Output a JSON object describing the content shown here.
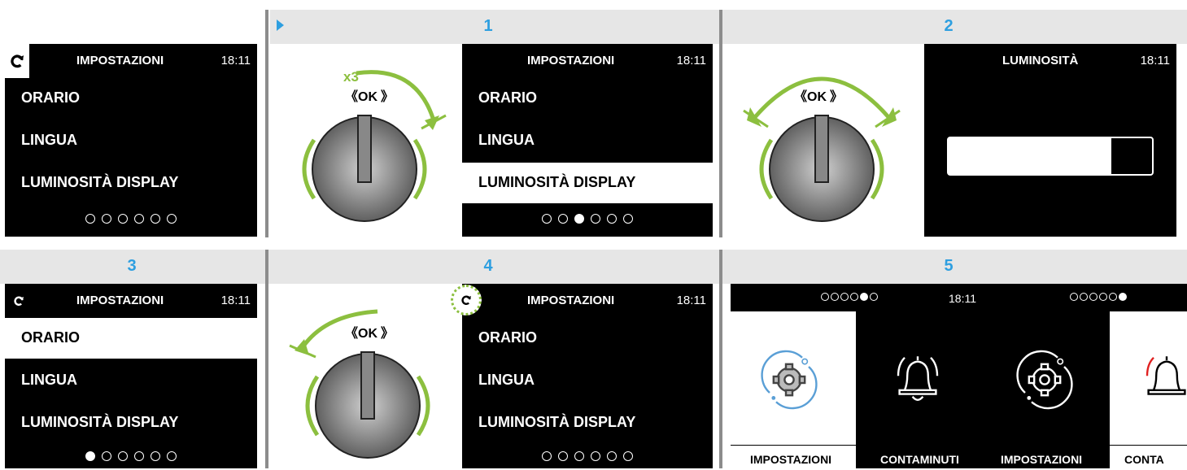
{
  "steps": {
    "s1": "1",
    "s2": "2",
    "s3": "3",
    "s4": "4",
    "s5": "5"
  },
  "time": "18:11",
  "settings": {
    "title": "IMPOSTAZIONI",
    "items": [
      "ORARIO",
      "LINGUA",
      "LUMINOSITÀ DISPLAY"
    ]
  },
  "brightness": {
    "title": "LUMINOSITÀ",
    "level": 0.8
  },
  "knob": {
    "ok_label": "OK",
    "repeat_label": "x3"
  },
  "menu5": {
    "tiles": [
      "IMPOSTAZIONI",
      "CONTAMINUTI",
      "IMPOSTAZIONI",
      "CONTA"
    ]
  },
  "colors": {
    "accent_green": "#8cbf3f",
    "step_blue": "#2e9fe0",
    "alert_red": "#e02020",
    "gear_blue": "#5a9fd6"
  },
  "icons": [
    "back-icon",
    "play-icon",
    "gear-icon",
    "bell-icon"
  ]
}
